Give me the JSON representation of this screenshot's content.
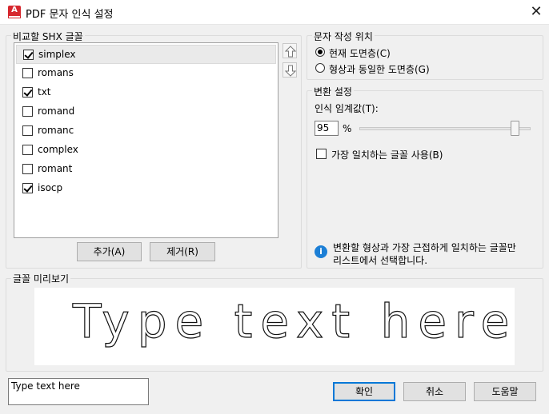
{
  "window": {
    "title": "PDF 문자 인식 설정",
    "app_icon_letter": "A",
    "close_glyph": "✕"
  },
  "shx_group": {
    "label": "비교할 SHX 글꼴",
    "fonts": [
      {
        "name": "simplex",
        "checked": true,
        "selected": true
      },
      {
        "name": "romans",
        "checked": false,
        "selected": false
      },
      {
        "name": "txt",
        "checked": true,
        "selected": false
      },
      {
        "name": "romand",
        "checked": false,
        "selected": false
      },
      {
        "name": "romanc",
        "checked": false,
        "selected": false
      },
      {
        "name": "complex",
        "checked": false,
        "selected": false
      },
      {
        "name": "romant",
        "checked": false,
        "selected": false
      },
      {
        "name": "isocp",
        "checked": true,
        "selected": false
      }
    ],
    "move_up_icon": "arrow-up-icon",
    "move_down_icon": "arrow-down-icon",
    "add_label": "추가(A)",
    "remove_label": "제거(R)"
  },
  "text_position": {
    "label": "문자 작성 위치",
    "option_current": "현재 도면층(C)",
    "option_same_as_geometry": "형상과 동일한 도면층(G)",
    "selected": "current"
  },
  "conversion": {
    "label": "변환 설정",
    "threshold_label": "인식 임계값(T):",
    "threshold_value": "95",
    "threshold_unit": "%",
    "threshold_fraction": 0.95,
    "best_match_label": "가장 일치하는 글꼴 사용(B)",
    "best_match_checked": false,
    "info_line1": "변환할 형상과 가장 근접하게 일치하는 글꼴만",
    "info_line2": "리스트에서 선택합니다."
  },
  "preview": {
    "label": "글꼴 미리보기",
    "sample_text": "Type text here"
  },
  "sample_input": {
    "value": "Type text here"
  },
  "buttons": {
    "ok": "확인",
    "cancel": "취소",
    "help": "도움말"
  },
  "colors": {
    "accent": "#0078d7",
    "app_icon": "#d6262d",
    "info_icon": "#1c7fd6"
  }
}
